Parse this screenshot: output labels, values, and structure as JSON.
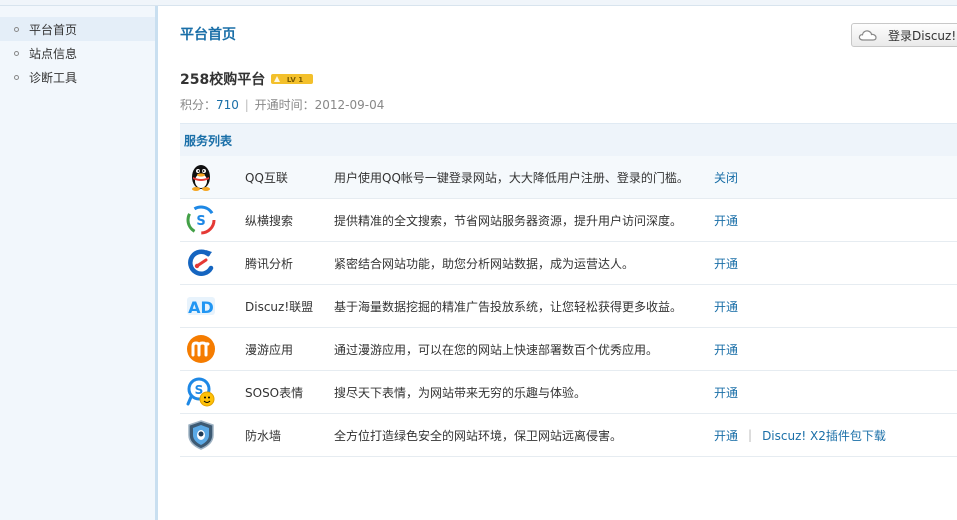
{
  "sidebar": {
    "items": [
      {
        "label": "平台首页",
        "active": true
      },
      {
        "label": "站点信息",
        "active": false
      },
      {
        "label": "诊断工具",
        "active": false
      }
    ]
  },
  "header": {
    "title": "平台首页",
    "login_button": "登录Discuz!"
  },
  "site": {
    "name": "258校购平台",
    "level_badge": "LV 1",
    "points_label": "积分：",
    "points_value": "710",
    "separator": "|",
    "opened_label": "开通时间：",
    "opened_value": "2012-09-04"
  },
  "services": {
    "title": "服务列表",
    "rows": [
      {
        "icon": "qq-penguin-icon",
        "name": "QQ互联",
        "desc": "用户使用QQ帐号一键登录网站，大大降低用户注册、登录的门槛。",
        "action": "关闭"
      },
      {
        "icon": "search-s-icon",
        "name": "纵横搜索",
        "desc": "提供精准的全文搜索，节省网站服务器资源，提升用户访问深度。",
        "action": "开通"
      },
      {
        "icon": "analytics-icon",
        "name": "腾讯分析",
        "desc": "紧密结合网站功能，助您分析网站数据，成为运营达人。",
        "action": "开通"
      },
      {
        "icon": "ad-icon",
        "name": "Discuz!联盟",
        "desc": "基于海量数据挖掘的精准广告投放系统，让您轻松获得更多收益。",
        "action": "开通"
      },
      {
        "icon": "manyou-icon",
        "name": "漫游应用",
        "desc": "通过漫游应用，可以在您的网站上快速部署数百个优秀应用。",
        "action": "开通"
      },
      {
        "icon": "soso-emoticon-icon",
        "name": "SOSO表情",
        "desc": "搜尽天下表情，为网站带来无穷的乐趣与体验。",
        "action": "开通"
      },
      {
        "icon": "firewall-shield-icon",
        "name": "防水墙",
        "desc": "全方位打造绿色安全的网站环境，保卫网站远离侵害。",
        "action": "开通",
        "extra": "Discuz! X2插件包下载"
      }
    ]
  }
}
